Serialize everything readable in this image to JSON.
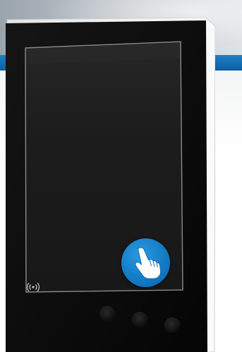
{
  "scene": {
    "subject": "panel-pc-with-touchscreen",
    "icons": [
      "touch-hand-icon",
      "nfc-icon"
    ],
    "colors": {
      "bezel": "#0b0b0b",
      "screen": "#1f1f1f",
      "touch_badge": "#1b86d1",
      "band": "#136db5",
      "housing": "#f2f2f2"
    }
  }
}
